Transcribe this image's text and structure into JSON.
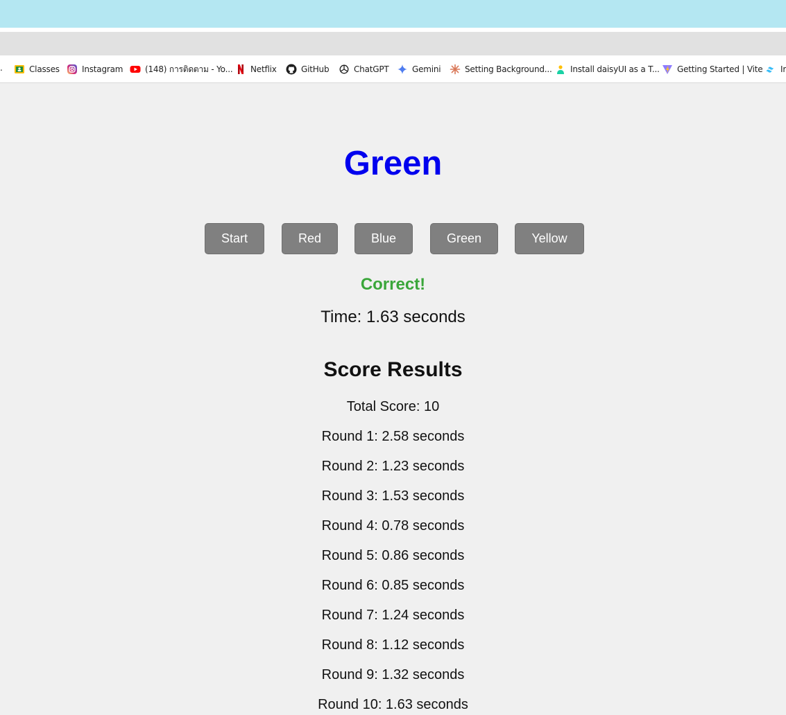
{
  "browser": {
    "bookmarks": [
      {
        "icon": "google-classroom-icon",
        "label": "Classes"
      },
      {
        "icon": "instagram-icon",
        "label": "Instagram"
      },
      {
        "icon": "youtube-icon",
        "label": "(148) การติดตาม - Yo..."
      },
      {
        "icon": "netflix-icon",
        "label": "Netflix"
      },
      {
        "icon": "github-icon",
        "label": "GitHub"
      },
      {
        "icon": "chatgpt-icon",
        "label": "ChatGPT"
      },
      {
        "icon": "gemini-icon",
        "label": "Gemini"
      },
      {
        "icon": "claude-icon",
        "label": "Setting Background..."
      },
      {
        "icon": "daisyui-icon",
        "label": "Install daisyUI as a T..."
      },
      {
        "icon": "vite-icon",
        "label": "Getting Started | Vite"
      },
      {
        "icon": "tailwind-icon",
        "label": "Ir"
      }
    ],
    "overflow_marker": "."
  },
  "game": {
    "color_word": "Green",
    "color_word_color": "#0000ee",
    "buttons": {
      "start": "Start",
      "red": "Red",
      "blue": "Blue",
      "green": "Green",
      "yellow": "Yellow"
    },
    "feedback": "Correct!",
    "feedback_color": "#3aa63a",
    "time": "Time: 1.63 seconds"
  },
  "results": {
    "title": "Score Results",
    "total": "Total Score: 10",
    "rounds": [
      "Round 1: 2.58 seconds",
      "Round 2: 1.23 seconds",
      "Round 3: 1.53 seconds",
      "Round 4: 0.78 seconds",
      "Round 5: 0.86 seconds",
      "Round 6: 0.85 seconds",
      "Round 7: 1.24 seconds",
      "Round 8: 1.12 seconds",
      "Round 9: 1.32 seconds",
      "Round 10: 1.63 seconds"
    ]
  }
}
